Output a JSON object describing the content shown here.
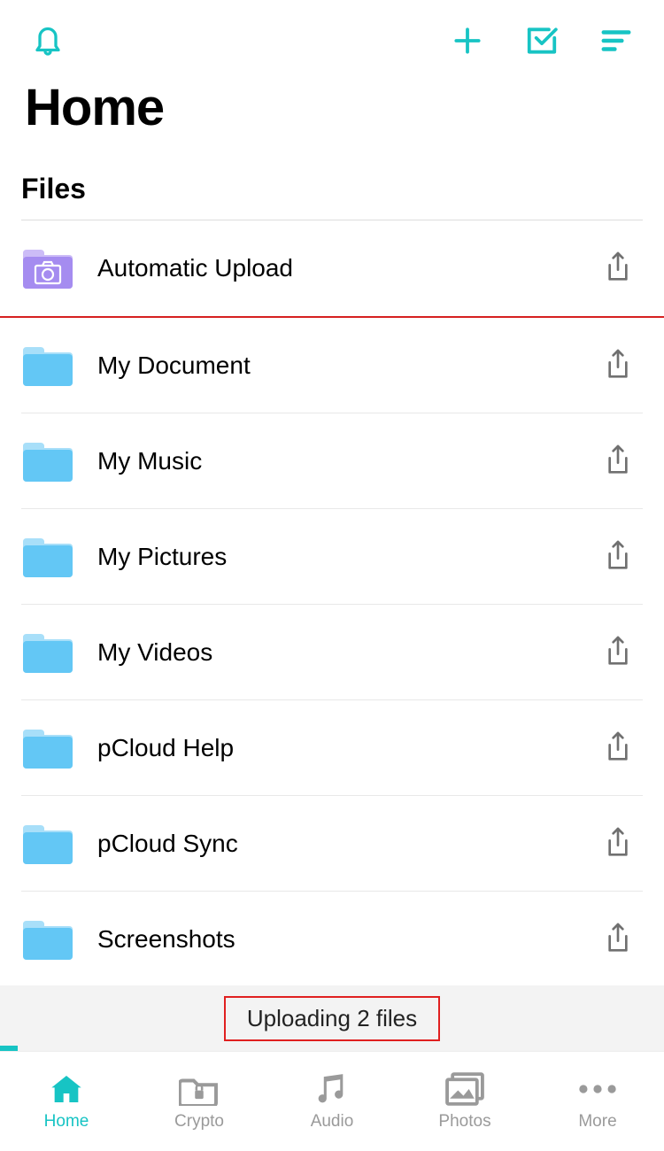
{
  "colors": {
    "accent": "#17c4c4",
    "folder": "#63c7f5",
    "folderTab": "#a8dff9",
    "autoFolder": "#a58cf0",
    "autoFolderLight": "#ccbcf7",
    "grey": "#9a9a9a",
    "shareGrey": "#707070",
    "red": "#e02020"
  },
  "header": {
    "title": "Home"
  },
  "section": {
    "title": "Files"
  },
  "files": [
    {
      "label": "Automatic Upload",
      "icon": "auto-upload-folder-icon",
      "highlighted": true
    },
    {
      "label": "My Document",
      "icon": "folder-icon"
    },
    {
      "label": "My Music",
      "icon": "folder-icon"
    },
    {
      "label": "My Pictures",
      "icon": "folder-icon"
    },
    {
      "label": "My Videos",
      "icon": "folder-icon"
    },
    {
      "label": "pCloud Help",
      "icon": "folder-icon"
    },
    {
      "label": "pCloud Sync",
      "icon": "folder-icon"
    },
    {
      "label": "Screenshots",
      "icon": "folder-icon"
    }
  ],
  "upload": {
    "status": "Uploading 2 files"
  },
  "tabs": [
    {
      "label": "Home",
      "icon": "home-icon",
      "active": true
    },
    {
      "label": "Crypto",
      "icon": "crypto-icon",
      "active": false
    },
    {
      "label": "Audio",
      "icon": "audio-icon",
      "active": false
    },
    {
      "label": "Photos",
      "icon": "photos-icon",
      "active": false
    },
    {
      "label": "More",
      "icon": "more-icon",
      "active": false
    }
  ]
}
